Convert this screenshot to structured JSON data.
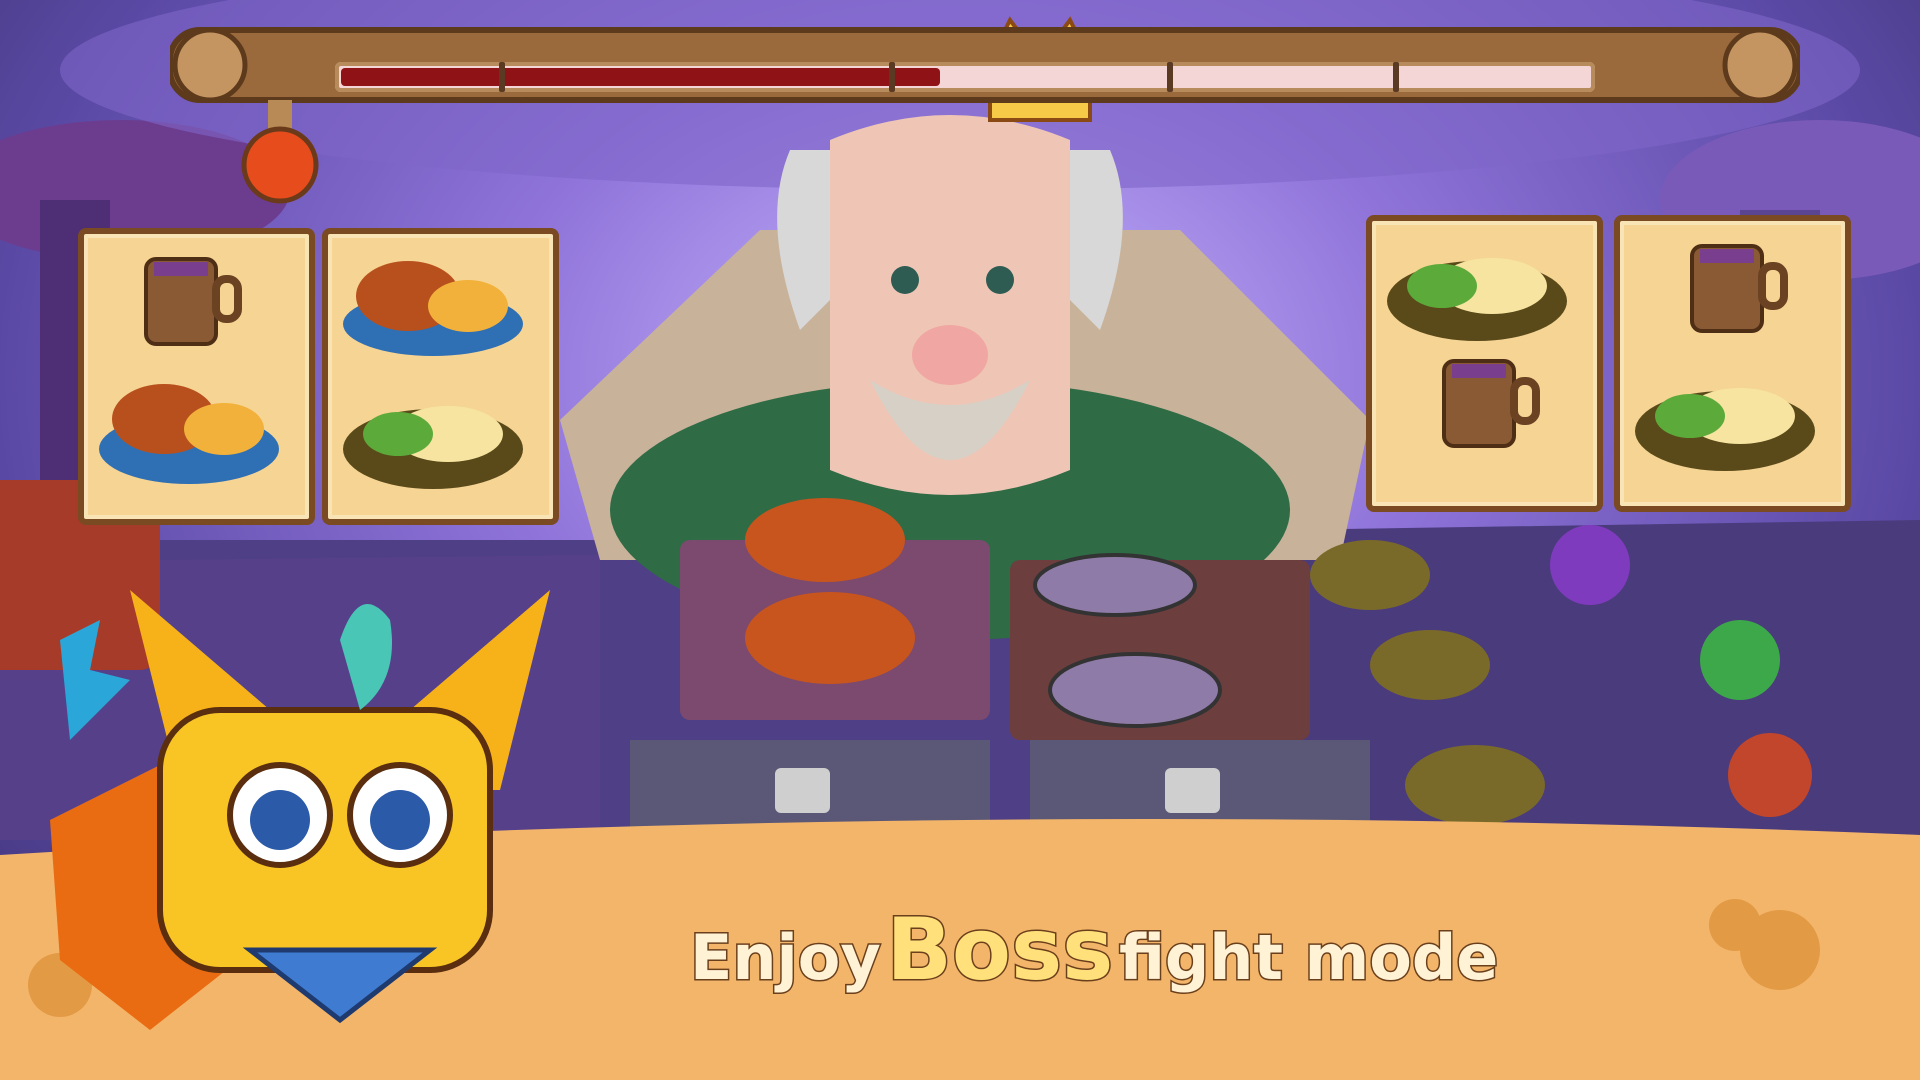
{
  "boss_health": {
    "fill_fraction": 0.48,
    "segment_count": 4
  },
  "slogan": {
    "part1": "Enjoy",
    "highlight": "Boss",
    "part2": "fight mode"
  },
  "orders": {
    "left": [
      {
        "items": [
          "mug-icon",
          "roast-chicken-plate-icon"
        ]
      },
      {
        "items": [
          "roast-chicken-plate-icon",
          "mashed-potato-salad-icon"
        ]
      }
    ],
    "right": [
      {
        "items": [
          "mashed-potato-salad-icon",
          "mug-icon"
        ]
      },
      {
        "items": [
          "mug-icon",
          "mashed-potato-salad-icon"
        ]
      }
    ]
  },
  "colors": {
    "health_fill": "#8e1216",
    "health_empty": "#f5d6d6",
    "banner": "#f3b56a",
    "slogan_text": "#fff2d5",
    "slogan_highlight": "#ffe07a"
  }
}
